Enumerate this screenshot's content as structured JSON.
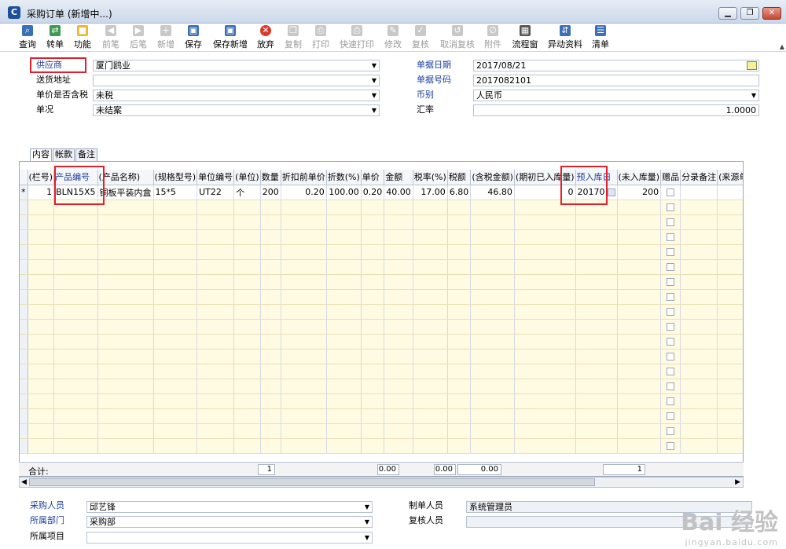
{
  "window": {
    "title": "采购订单 (新增中...)",
    "app_icon": "C",
    "min": "▁",
    "restore": "❐",
    "close": "✕"
  },
  "toolbar": {
    "items": [
      {
        "label": "查询",
        "icon": "search-icon"
      },
      {
        "label": "转单",
        "icon": "transfer-icon"
      },
      {
        "label": "功能",
        "icon": "cube-icon"
      },
      {
        "label": "前笔",
        "icon": "prev-icon"
      },
      {
        "label": "后笔",
        "icon": "next-icon"
      },
      {
        "label": "新增",
        "icon": "new-icon"
      },
      {
        "label": "保存",
        "icon": "save-icon"
      },
      {
        "label": "保存新增",
        "icon": "save-new-icon"
      },
      {
        "label": "放弃",
        "icon": "cancel-icon"
      },
      {
        "label": "复制",
        "icon": "copy-icon"
      },
      {
        "label": "打印",
        "icon": "print-icon"
      },
      {
        "label": "快速打印",
        "icon": "quick-print-icon"
      },
      {
        "label": "修改",
        "icon": "edit-icon"
      },
      {
        "label": "复核",
        "icon": "review-icon"
      },
      {
        "label": "取消复核",
        "icon": "unreview-icon"
      },
      {
        "label": "附件",
        "icon": "attachment-icon"
      },
      {
        "label": "流程窗",
        "icon": "flow-icon"
      },
      {
        "label": "异动资料",
        "icon": "change-icon"
      },
      {
        "label": "清单",
        "icon": "list-icon"
      }
    ]
  },
  "header": {
    "supplier_label": "供应商",
    "supplier_value": "厦门鸥业",
    "address_label": "送货地址",
    "address_value": "",
    "tax_label": "单价是否含税",
    "tax_value": "未税",
    "status_label": "单况",
    "status_value": "未结案",
    "date_label": "单据日期",
    "date_value": "2017/08/21",
    "number_label": "单据号码",
    "number_value": "2017082101",
    "currency_label": "币别",
    "currency_value": "人民币",
    "rate_label": "汇率",
    "rate_value": "1.0000"
  },
  "tabs": [
    "内容",
    "帐款",
    "备注"
  ],
  "grid": {
    "columns": [
      "(栏号)",
      "产品编号",
      "(产品名称)",
      "(规格型号)",
      "单位编号",
      "(单位)",
      "数量",
      "折扣前单价",
      "折数(%)",
      "单价",
      "金额",
      "税率(%)",
      "税额",
      "(含税金额)",
      "(期初已入库量)",
      "预入库日",
      "(未入库量)",
      "赠品",
      "分录备注",
      "(来源单别"
    ],
    "row": {
      "marker": "*",
      "line": "1",
      "product_code": "BLN15X5",
      "product_name": "铜板平装内盒",
      "spec": "15*5",
      "unit_code": "UT22",
      "unit": "个",
      "qty": "200",
      "price_before": "0.20",
      "discount": "100.00",
      "price": "0.20",
      "amount": "40.00",
      "tax_rate": "17.00",
      "tax": "6.80",
      "amount_incl": "46.80",
      "opening_in": "0",
      "expected_date": "20170",
      "not_in": "200"
    },
    "totals_label": "合计:",
    "totals": {
      "qty": "1",
      "amount": "0.00",
      "tax": "0.00",
      "amount_incl": "0.00",
      "not_in": "1"
    }
  },
  "footer": {
    "buyer_label": "采购人员",
    "buyer_value": "邱艺锋",
    "dept_label": "所属部门",
    "dept_value": "采购部",
    "project_label": "所属项目",
    "project_value": "",
    "maker_label": "制单人员",
    "maker_value": "系统管理员",
    "reviewer_label": "复核人员",
    "reviewer_value": ""
  },
  "watermark": {
    "text": "Bai 经验",
    "url": "jingyan.baidu.com"
  }
}
